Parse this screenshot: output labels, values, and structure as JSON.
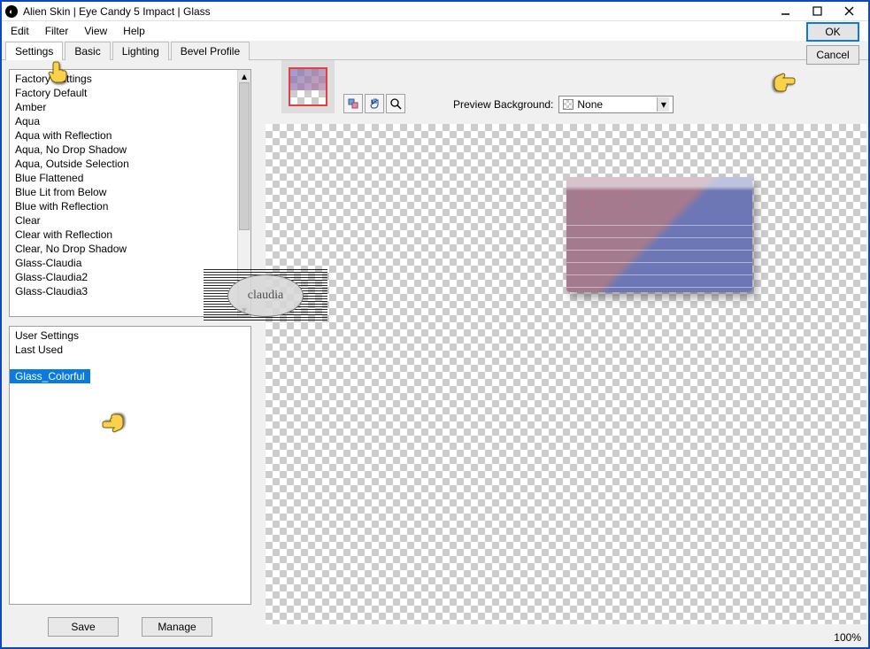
{
  "window": {
    "title": "Alien Skin | Eye Candy 5 Impact | Glass"
  },
  "menu": {
    "edit": "Edit",
    "filter": "Filter",
    "view": "View",
    "help": "Help"
  },
  "tabs": {
    "settings": "Settings",
    "basic": "Basic",
    "lighting": "Lighting",
    "bevel": "Bevel Profile"
  },
  "factory": {
    "header": "Factory Settings",
    "items": [
      "Factory Default",
      "Amber",
      "Aqua",
      "Aqua with Reflection",
      "Aqua, No Drop Shadow",
      "Aqua, Outside Selection",
      "Blue Flattened",
      "Blue Lit from Below",
      "Blue with Reflection",
      "Clear",
      "Clear with Reflection",
      "Clear, No Drop Shadow",
      "Glass-Claudia",
      "Glass-Claudia2",
      "Glass-Claudia3"
    ]
  },
  "user": {
    "header": "User Settings",
    "last_used": "Last Used",
    "selected": "Glass_Colorful"
  },
  "buttons": {
    "save": "Save",
    "manage": "Manage",
    "ok": "OK",
    "cancel": "Cancel"
  },
  "preview": {
    "bg_label": "Preview Background:",
    "bg_value": "None"
  },
  "status": {
    "zoom": "100%"
  },
  "watermark": "claudia"
}
